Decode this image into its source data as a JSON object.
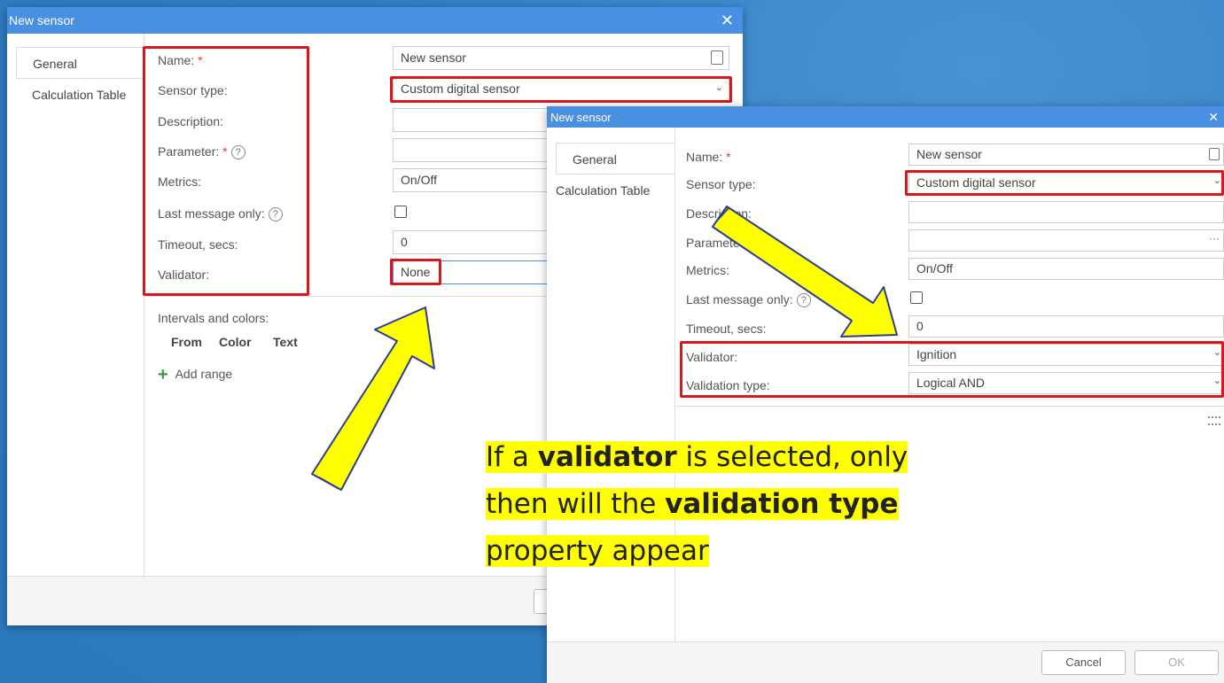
{
  "left_dialog": {
    "title": "New sensor",
    "tabs": [
      "General",
      "Calculation Table"
    ],
    "labels": {
      "name": "Name:",
      "sensor_type": "Sensor type:",
      "description": "Description:",
      "parameter": "Parameter:",
      "metrics": "Metrics:",
      "last_message_only": "Last message only:",
      "timeout": "Timeout, secs:",
      "validator": "Validator:"
    },
    "values": {
      "name": "New sensor",
      "sensor_type": "Custom digital sensor",
      "metrics": "On/Off",
      "timeout": "0",
      "validator": "None"
    },
    "intervals": {
      "heading": "Intervals and colors:",
      "col_from": "From",
      "col_color": "Color",
      "col_text": "Text",
      "add_range": "Add range"
    }
  },
  "right_dialog": {
    "title": "New sensor",
    "tabs": [
      "General",
      "Calculation Table"
    ],
    "labels": {
      "name": "Name:",
      "sensor_type": "Sensor type:",
      "description": "Description:",
      "parameter": "Parameter:",
      "metrics": "Metrics:",
      "last_message_only": "Last message only:",
      "timeout": "Timeout, secs:",
      "validator": "Validator:",
      "validation_type": "Validation type:"
    },
    "values": {
      "name": "New sensor",
      "sensor_type": "Custom digital sensor",
      "metrics": "On/Off",
      "timeout": "0",
      "validator": "Ignition",
      "validation_type": "Logical AND"
    },
    "buttons": {
      "cancel": "Cancel",
      "ok": "OK"
    }
  },
  "shared": {
    "required_mark": "*",
    "help_glyph": "?",
    "close_glyph": "✕",
    "caret_glyph": "⌄",
    "more_glyph": "···",
    "plus_glyph": "+"
  },
  "callout": {
    "part1": "If a ",
    "bold1": "validator",
    "part2": " is selected, only",
    "part3": "then will the ",
    "bold2": "validation type",
    "part4": "property appear"
  },
  "colors": {
    "background": "#2f7fc6",
    "titlebar": "#4a90e2",
    "highlight_box": "#d9171c",
    "arrow_fill": "#ffff00",
    "arrow_stroke": "#2a3f8f",
    "callout_highlight": "#ffff00"
  }
}
